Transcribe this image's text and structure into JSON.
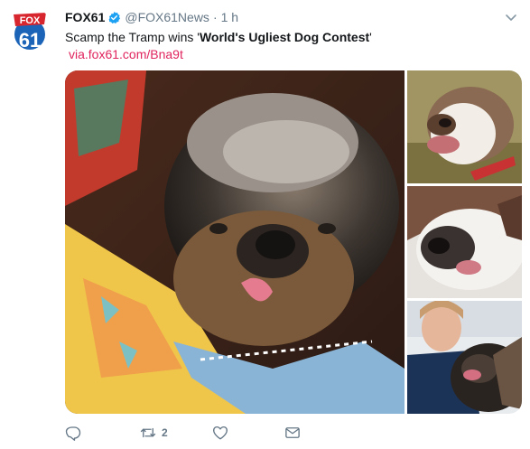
{
  "tweet": {
    "display_name": "FOX61",
    "handle": "@FOX61News",
    "separator": "·",
    "time": "1 h",
    "text_prefix": "Scamp the Tramp wins '",
    "text_bold": "World's Ugliest Dog Contest",
    "text_suffix": "'",
    "link": "via.fox61.com/Bna9t"
  },
  "avatar": {
    "logo_word": "FOX",
    "logo_number": "61"
  },
  "actions": {
    "reply_count": "",
    "retweet_count": "2",
    "like_count": "",
    "icons": [
      "reply-icon",
      "retweet-icon",
      "like-icon",
      "dm-icon"
    ]
  },
  "colors": {
    "link": "#e0245e",
    "muted": "#657786",
    "verified": "#1da1f2",
    "brand_red": "#d8262e",
    "brand_blue": "#1b64b7"
  }
}
